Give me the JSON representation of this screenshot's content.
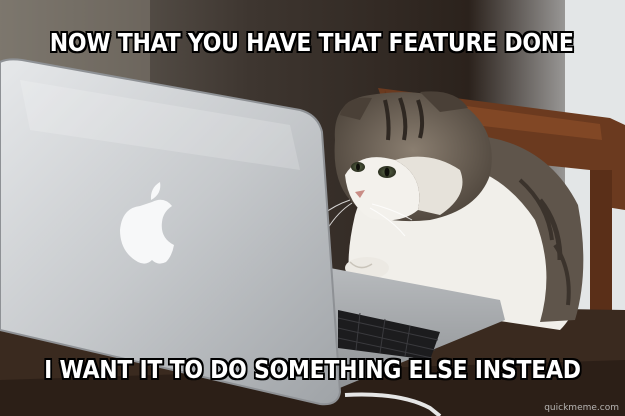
{
  "meme": {
    "top_text": "NOW THAT YOU HAVE THAT FEATURE DONE",
    "bottom_text": "I WANT IT TO DO SOMETHING ELSE INSTEAD",
    "watermark": "quickmeme.com"
  },
  "colors": {
    "caption_text": "#ffffff",
    "caption_outline": "#000000",
    "laptop_silver": "#c9ccd0",
    "cat_white": "#f1efea",
    "cat_tabby": "#6e6256",
    "chair_wood": "#6b3a1f",
    "table": "#3a2a1f"
  }
}
